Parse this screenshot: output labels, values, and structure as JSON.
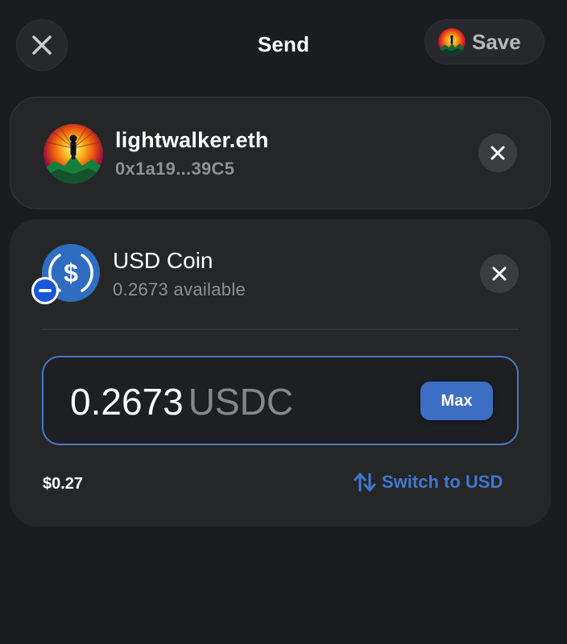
{
  "header": {
    "title": "Send",
    "close_icon": "close-icon",
    "save_label": "Save"
  },
  "recipient": {
    "name": "lightwalker.eth",
    "address": "0x1a19...39C5",
    "remove_icon": "close-icon"
  },
  "asset": {
    "name": "USD Coin",
    "available": "0.2673 available",
    "icon": "usdc-coin-icon",
    "badge_icon": "minus-badge-icon",
    "remove_icon": "close-icon"
  },
  "amount": {
    "value": "0.2673",
    "unit": "USDC",
    "max_label": "Max"
  },
  "footer": {
    "fiat_value": "$0.27",
    "switch_label": "Switch to USD",
    "switch_icon": "swap-vertical-icon"
  },
  "colors": {
    "background": "#1b1c1e",
    "card": "#252628",
    "accent": "#3c6fc4",
    "link": "#3f78cf",
    "muted_text": "#8e9096",
    "usdc_blue": "#2775ca"
  }
}
